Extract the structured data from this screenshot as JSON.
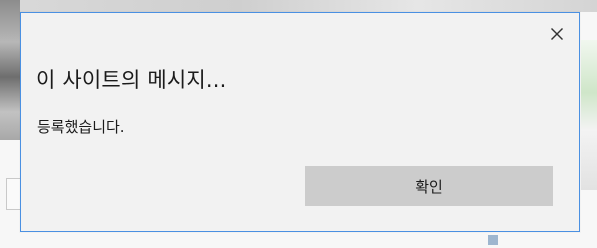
{
  "dialog": {
    "title": "이 사이트의 메시지...",
    "message": "등록했습니다.",
    "ok_label": "확인",
    "close_icon": "close-icon",
    "accent_border": "#4a90e2",
    "button_bg": "#cccccc"
  }
}
